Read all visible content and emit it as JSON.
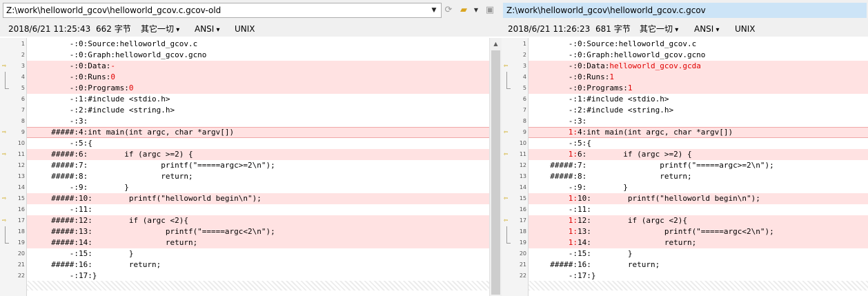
{
  "left": {
    "path": "Z:\\work\\helloworld_gcov\\helloworld_gcov.c.gcov-old",
    "date": "2018/6/21 11:25:43",
    "size": "662 字节",
    "filter": "其它一切",
    "encoding": "ANSI",
    "eol": "UNIX",
    "lines": [
      {
        "n": "1",
        "cnt": "-:",
        "text": "0:Source:helloworld_gcov.c",
        "diff": false
      },
      {
        "n": "2",
        "cnt": "-:",
        "text": "0:Graph:helloworld_gcov.gcno",
        "diff": false
      },
      {
        "n": "3",
        "cnt": "-:",
        "text": "0:Data:",
        "red": "-",
        "diff": true,
        "marker": "arrow"
      },
      {
        "n": "4",
        "cnt": "-:",
        "text": "0:Runs:",
        "red": "0",
        "diff": true,
        "marker": "bracket"
      },
      {
        "n": "5",
        "cnt": "-:",
        "text": "0:Programs:",
        "red": "0",
        "diff": true,
        "marker": "bracket-end"
      },
      {
        "n": "6",
        "cnt": "-:",
        "text": "1:#include <stdio.h>",
        "diff": false
      },
      {
        "n": "7",
        "cnt": "-:",
        "text": "2:#include <string.h>",
        "diff": false
      },
      {
        "n": "8",
        "cnt": "-:",
        "text": "3:",
        "diff": false
      },
      {
        "n": "9",
        "cnt": "#####:",
        "text": "4:int main(int argc, char *argv[])",
        "diff": true,
        "marker": "arrow",
        "sel": true
      },
      {
        "n": "10",
        "cnt": "-:",
        "text": "5:{",
        "diff": false
      },
      {
        "n": "11",
        "cnt": "#####:",
        "text": "6:        if (argc >=2) {",
        "diff": true,
        "marker": "arrow"
      },
      {
        "n": "12",
        "cnt": "#####:",
        "text": "7:                printf(\"=====argc>=2\\n\");",
        "diff": false
      },
      {
        "n": "13",
        "cnt": "#####:",
        "text": "8:                return;",
        "diff": false
      },
      {
        "n": "14",
        "cnt": "-:",
        "text": "9:        }",
        "diff": false
      },
      {
        "n": "15",
        "cnt": "#####:",
        "text": "10:        printf(\"helloworld begin\\n\");",
        "diff": true,
        "marker": "arrow"
      },
      {
        "n": "16",
        "cnt": "-:",
        "text": "11:",
        "diff": false
      },
      {
        "n": "17",
        "cnt": "#####:",
        "text": "12:        if (argc <2){",
        "diff": true,
        "marker": "arrow"
      },
      {
        "n": "18",
        "cnt": "#####:",
        "text": "13:                printf(\"=====argc<2\\n\");",
        "diff": true,
        "marker": "bracket"
      },
      {
        "n": "19",
        "cnt": "#####:",
        "text": "14:                return;",
        "diff": true,
        "marker": "bracket-end"
      },
      {
        "n": "20",
        "cnt": "-:",
        "text": "15:        }",
        "diff": false
      },
      {
        "n": "21",
        "cnt": "#####:",
        "text": "16:        return;",
        "diff": false
      },
      {
        "n": "22",
        "cnt": "-:",
        "text": "17:}",
        "diff": false
      }
    ]
  },
  "right": {
    "path": "Z:\\work\\helloworld_gcov\\helloworld_gcov.c.gcov",
    "date": "2018/6/21 11:26:23",
    "size": "681 字节",
    "filter": "其它一切",
    "encoding": "ANSI",
    "eol": "UNIX",
    "lines": [
      {
        "n": "1",
        "cnt": "-:",
        "text": "0:Source:helloworld_gcov.c",
        "diff": false
      },
      {
        "n": "2",
        "cnt": "-:",
        "text": "0:Graph:helloworld_gcov.gcno",
        "diff": false
      },
      {
        "n": "3",
        "cnt": "-:",
        "text": "0:Data:",
        "red": "helloworld_gcov.gcda",
        "diff": true,
        "marker": "arrow"
      },
      {
        "n": "4",
        "cnt": "-:",
        "text": "0:Runs:",
        "red": "1",
        "diff": true,
        "marker": "bracket"
      },
      {
        "n": "5",
        "cnt": "-:",
        "text": "0:Programs:",
        "red": "1",
        "diff": true,
        "marker": "bracket-end"
      },
      {
        "n": "6",
        "cnt": "-:",
        "text": "1:#include <stdio.h>",
        "diff": false
      },
      {
        "n": "7",
        "cnt": "-:",
        "text": "2:#include <string.h>",
        "diff": false
      },
      {
        "n": "8",
        "cnt": "-:",
        "text": "3:",
        "diff": false
      },
      {
        "n": "9",
        "cnt": "1:",
        "cntRed": true,
        "text": "4:int main(int argc, char *argv[])",
        "diff": true,
        "marker": "arrow",
        "sel": true
      },
      {
        "n": "10",
        "cnt": "-:",
        "text": "5:{",
        "diff": false
      },
      {
        "n": "11",
        "cnt": "1:",
        "cntRed": true,
        "text": "6:        if (argc >=2) {",
        "diff": true,
        "marker": "arrow"
      },
      {
        "n": "12",
        "cnt": "#####:",
        "text": "7:                printf(\"=====argc>=2\\n\");",
        "diff": false
      },
      {
        "n": "13",
        "cnt": "#####:",
        "text": "8:                return;",
        "diff": false
      },
      {
        "n": "14",
        "cnt": "-:",
        "text": "9:        }",
        "diff": false
      },
      {
        "n": "15",
        "cnt": "1:",
        "cntRed": true,
        "text": "10:        printf(\"helloworld begin\\n\");",
        "diff": true,
        "marker": "arrow"
      },
      {
        "n": "16",
        "cnt": "-:",
        "text": "11:",
        "diff": false
      },
      {
        "n": "17",
        "cnt": "1:",
        "cntRed": true,
        "text": "12:        if (argc <2){",
        "diff": true,
        "marker": "arrow"
      },
      {
        "n": "18",
        "cnt": "1:",
        "cntRed": true,
        "text": "13:                printf(\"=====argc<2\\n\");",
        "diff": true,
        "marker": "bracket"
      },
      {
        "n": "19",
        "cnt": "1:",
        "cntRed": true,
        "text": "14:                return;",
        "diff": true,
        "marker": "bracket-end"
      },
      {
        "n": "20",
        "cnt": "-:",
        "text": "15:        }",
        "diff": false
      },
      {
        "n": "21",
        "cnt": "#####:",
        "text": "16:        return;",
        "diff": false
      },
      {
        "n": "22",
        "cnt": "-:",
        "text": "17:}",
        "diff": false
      }
    ]
  },
  "icons": {
    "combo": "chevron-down-icon",
    "refresh": "refresh-icon",
    "open": "folder-open-icon",
    "save": "save-icon",
    "left_marker": "arrow-right-icon",
    "right_marker": "arrow-left-icon"
  },
  "colors": {
    "diff_bg": "#ffe2e2",
    "diff_text": "#e00000",
    "marker": "#c9a000",
    "active_path_bg": "#cce4f7"
  }
}
